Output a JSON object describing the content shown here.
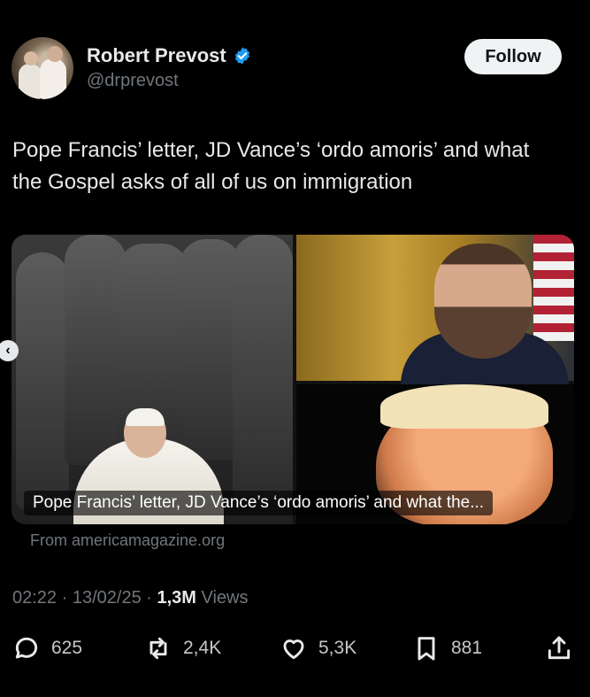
{
  "author": {
    "display_name": "Robert Prevost",
    "handle": "@drprevost",
    "verified": true,
    "verified_color": "#1d9bf0"
  },
  "follow_label": "Follow",
  "tweet_text": "Pope Francis’ letter, JD Vance’s ‘ordo amoris’ and what the Gospel asks of all of us on immigration",
  "card": {
    "title": "Pope Francis’ letter, JD Vance’s ‘ordo amoris’ and what the...",
    "source": "From americamagazine.org"
  },
  "meta": {
    "time": "02:22",
    "separator": " · ",
    "date": "13/02/25",
    "views_count": "1,3M",
    "views_label": "Views"
  },
  "actions": {
    "replies": "625",
    "reposts": "2,4K",
    "likes": "5,3K",
    "bookmarks": "881"
  },
  "icons": {
    "carousel": "chevron-left-icon",
    "reply": "reply-icon",
    "repost": "repost-icon",
    "like": "heart-icon",
    "bookmark": "bookmark-icon",
    "share": "share-icon"
  }
}
